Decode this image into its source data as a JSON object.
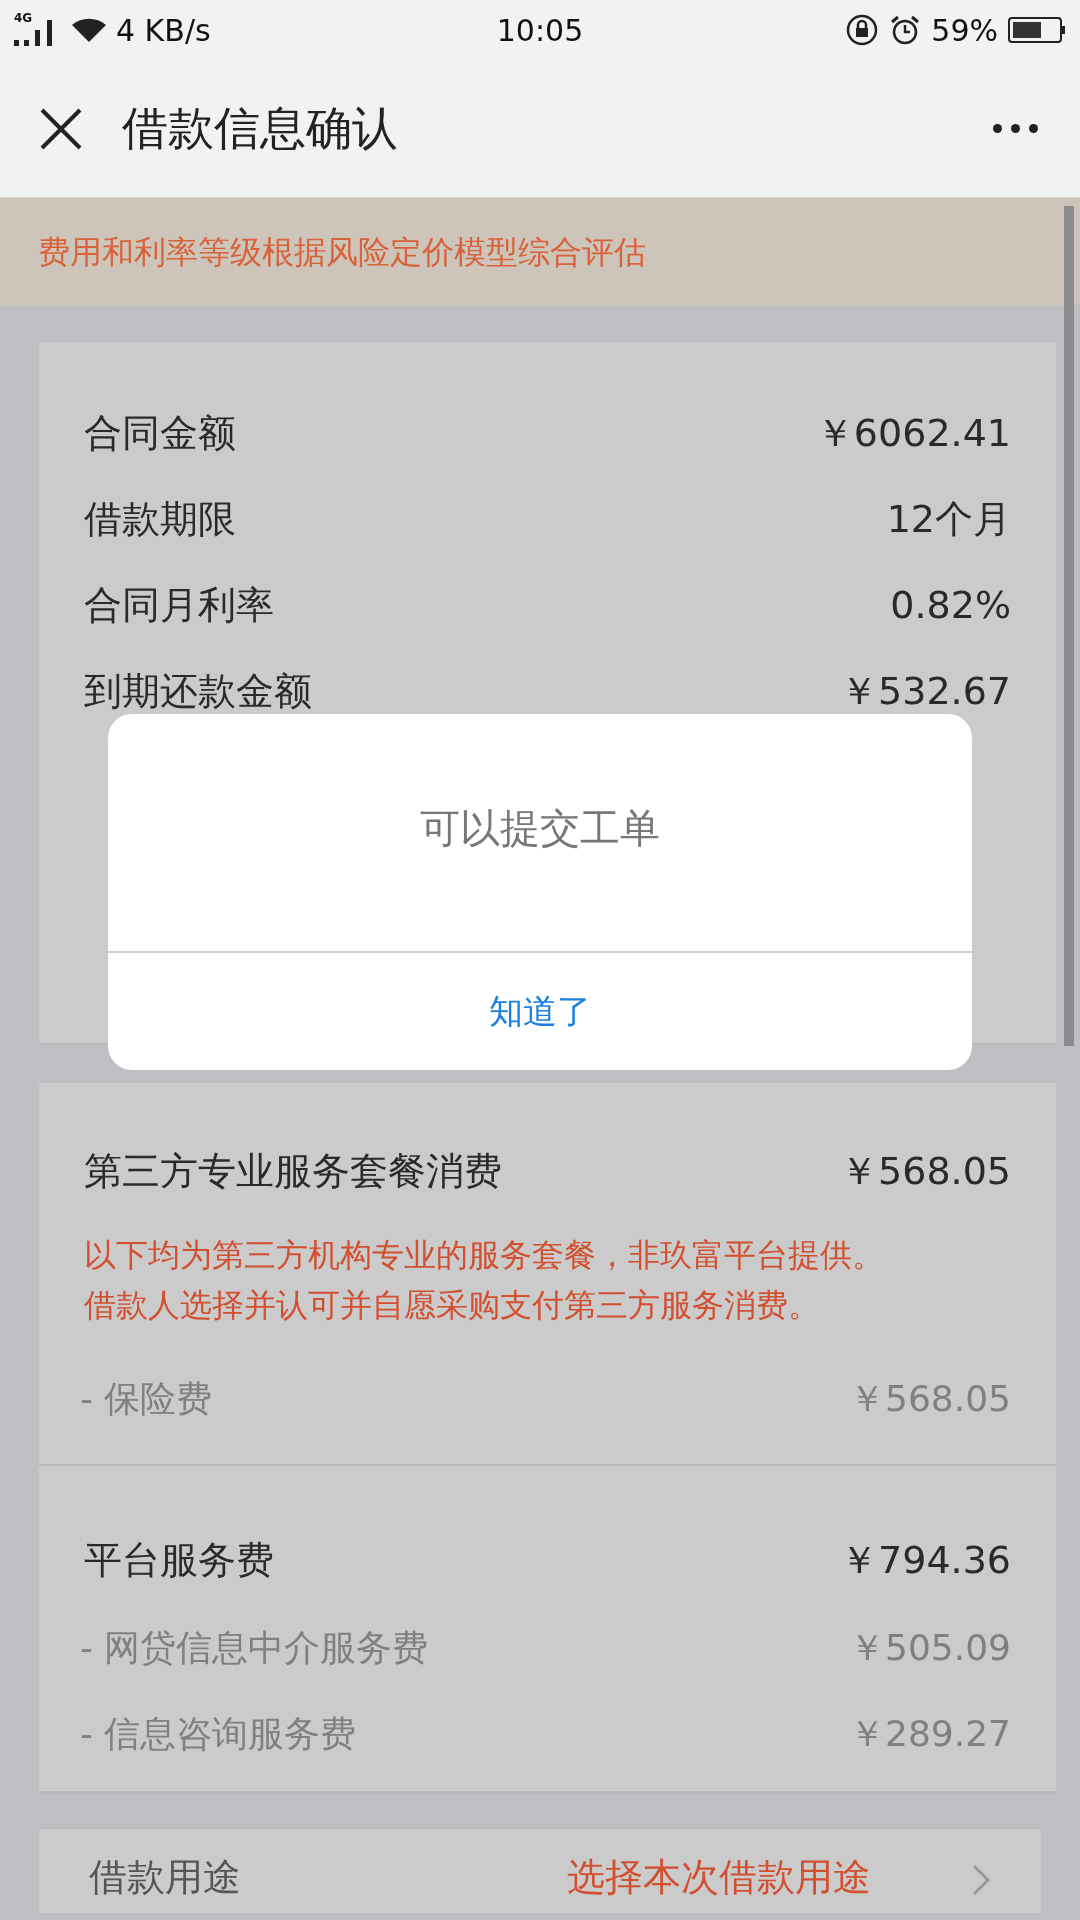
{
  "status_bar": {
    "network": "4G",
    "speed": "4 KB/s",
    "time": "10:05",
    "battery": "59%"
  },
  "header": {
    "title": "借款信息确认"
  },
  "notice": "费用和利率等级根据风险定价模型综合评估",
  "summary": {
    "rows": [
      {
        "label": "合同金额",
        "value": "￥6062.41"
      },
      {
        "label": "借款期限",
        "value": "12个月"
      },
      {
        "label": "合同月利率",
        "value": "0.82%"
      },
      {
        "label": "到期还款金额",
        "value": "￥532.67"
      }
    ]
  },
  "dialog": {
    "message": "可以提交工单",
    "button": "知道了"
  },
  "service_package": {
    "title": "第三方专业服务套餐消费",
    "amount": "￥568.05",
    "notice_lines": [
      "以下均为第三方机构专业的服务套餐，非玖富平台提供。",
      "借款人选择并认可并自愿采购支付第三方服务消费。"
    ],
    "items": [
      {
        "label": "- 保险费",
        "value": "￥568.05"
      }
    ]
  },
  "platform_fee": {
    "title": "平台服务费",
    "amount": "￥794.36",
    "items": [
      {
        "label": "- 网贷信息中介服务费",
        "value": "￥505.09"
      },
      {
        "label": "- 信息咨询服务费",
        "value": "￥289.27"
      }
    ]
  },
  "purpose": {
    "label": "借款用途",
    "value": "选择本次借款用途"
  }
}
